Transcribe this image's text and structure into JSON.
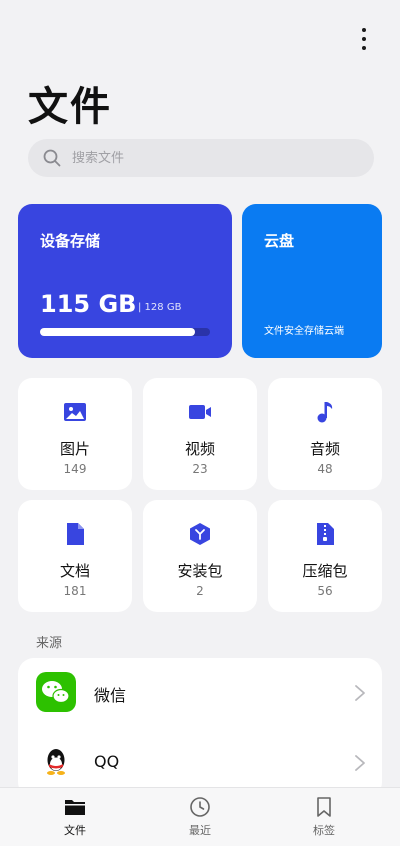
{
  "header": {
    "title": "文件",
    "more_icon": "more-vertical-icon"
  },
  "search": {
    "placeholder": "搜索文件",
    "icon": "search-icon"
  },
  "storage": {
    "title": "设备存储",
    "used": "115 GB",
    "total": "| 128 GB",
    "progress_fraction": 0.91,
    "color": "#3845e0"
  },
  "cloud": {
    "title": "云盘",
    "subtitle": "文件安全存储云端",
    "color": "#0a7bf2"
  },
  "categories": [
    {
      "label": "图片",
      "count": "149",
      "icon": "image-icon"
    },
    {
      "label": "视频",
      "count": "23",
      "icon": "video-icon"
    },
    {
      "label": "音频",
      "count": "48",
      "icon": "music-note-icon"
    },
    {
      "label": "文档",
      "count": "181",
      "icon": "document-icon"
    },
    {
      "label": "安装包",
      "count": "2",
      "icon": "package-icon"
    },
    {
      "label": "压缩包",
      "count": "56",
      "icon": "archive-icon"
    }
  ],
  "sources": {
    "section_label": "来源",
    "items": [
      {
        "name": "微信",
        "icon": "wechat-logo"
      },
      {
        "name": "QQ",
        "icon": "qq-logo"
      }
    ]
  },
  "nav": [
    {
      "label": "文件",
      "icon": "folder-icon",
      "active": true
    },
    {
      "label": "最近",
      "icon": "clock-icon",
      "active": false
    },
    {
      "label": "标签",
      "icon": "bookmark-icon",
      "active": false
    }
  ],
  "accent": "#3845e0"
}
